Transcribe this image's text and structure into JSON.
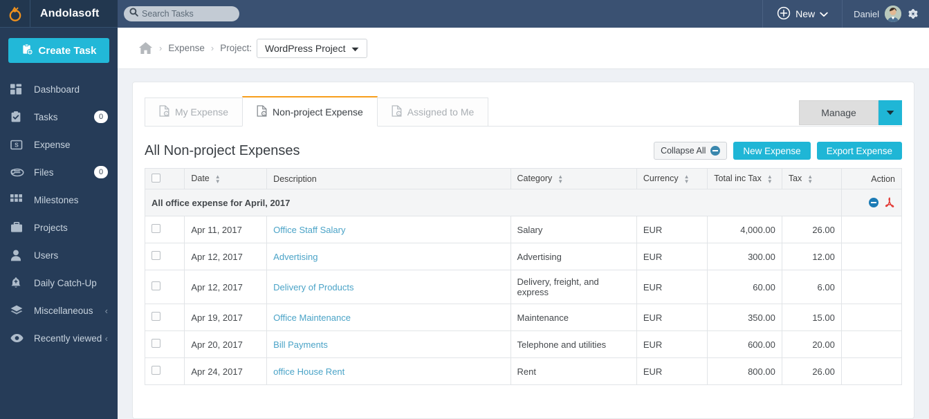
{
  "brand": {
    "name": "Andolasoft",
    "logo_icon": "ring-logo-icon"
  },
  "sidebar": {
    "create_task_label": "Create Task",
    "items": [
      {
        "label": "Dashboard",
        "icon": "dashboard-icon",
        "badge": "",
        "caret": ""
      },
      {
        "label": "Tasks",
        "icon": "tasks-clipboard-icon",
        "badge": "0",
        "caret": ""
      },
      {
        "label": "Expense",
        "icon": "expense-money-icon",
        "badge": "",
        "caret": ""
      },
      {
        "label": "Files",
        "icon": "paperclip-icon",
        "badge": "0",
        "caret": ""
      },
      {
        "label": "Milestones",
        "icon": "grid-icon",
        "badge": "",
        "caret": ""
      },
      {
        "label": "Projects",
        "icon": "briefcase-icon",
        "badge": "",
        "caret": ""
      },
      {
        "label": "Users",
        "icon": "user-icon",
        "badge": "",
        "caret": ""
      },
      {
        "label": "Daily Catch-Up",
        "icon": "bell-icon",
        "badge": "",
        "caret": ""
      },
      {
        "label": "Miscellaneous",
        "icon": "layers-icon",
        "badge": "",
        "caret": "‹"
      },
      {
        "label": "Recently viewed",
        "icon": "eye-icon",
        "badge": "",
        "caret": "‹"
      }
    ]
  },
  "topbar": {
    "search_placeholder": "Search Tasks",
    "search_value": "",
    "search_icon": "search-icon",
    "new_label": "New",
    "new_icon": "plus-circle-icon",
    "user_name": "Daniel",
    "gear_icon": "gear-icon",
    "avatar_icon": "avatar"
  },
  "breadcrumb": {
    "home_icon": "home-icon",
    "separator": "›",
    "expense_label": "Expense",
    "project_label": "Project:",
    "project_selected": "WordPress Project"
  },
  "tabs": [
    {
      "label": "My Expense",
      "icon": "expense-doc-icon",
      "active": false
    },
    {
      "label": "Non-project Expense",
      "icon": "expense-doc-icon",
      "active": true
    },
    {
      "label": "Assigned to Me",
      "icon": "expense-doc-icon",
      "active": false
    }
  ],
  "manage": {
    "label": "Manage",
    "caret_icon": "chevron-down-icon"
  },
  "main": {
    "title": "All Non-project Expenses",
    "collapse_all_label": "Collapse All",
    "collapse_icon": "minus-circle-icon",
    "new_expense_label": "New Expense",
    "export_expense_label": "Export Expense"
  },
  "table": {
    "columns": [
      {
        "label": "",
        "key": "check",
        "align": "left",
        "sortable": false
      },
      {
        "label": "Date",
        "key": "date",
        "align": "left",
        "sortable": true
      },
      {
        "label": "Description",
        "key": "description",
        "align": "left",
        "sortable": false
      },
      {
        "label": "Category",
        "key": "category",
        "align": "left",
        "sortable": true
      },
      {
        "label": "Currency",
        "key": "currency",
        "align": "left",
        "sortable": true
      },
      {
        "label": "Total inc Tax",
        "key": "total",
        "align": "right",
        "sortable": true
      },
      {
        "label": "Tax",
        "key": "tax",
        "align": "right",
        "sortable": true
      },
      {
        "label": "Action",
        "key": "action",
        "align": "right",
        "sortable": false
      }
    ],
    "group": {
      "title": "All office expense for April, 2017",
      "collapse_icon": "minus-circle-icon",
      "pdf_icon": "pdf-icon"
    },
    "rows": [
      {
        "date": "Apr 11, 2017",
        "description": "Office Staff Salary",
        "category": "Salary",
        "currency": "EUR",
        "total": "4,000.00",
        "tax": "26.00"
      },
      {
        "date": "Apr 12, 2017",
        "description": "Advertising",
        "category": "Advertising",
        "currency": "EUR",
        "total": "300.00",
        "tax": "12.00"
      },
      {
        "date": "Apr 12, 2017",
        "description": "Delivery of Products",
        "category": "Delivery, freight, and express",
        "currency": "EUR",
        "total": "60.00",
        "tax": "6.00"
      },
      {
        "date": "Apr 19, 2017",
        "description": "Office Maintenance",
        "category": "Maintenance",
        "currency": "EUR",
        "total": "350.00",
        "tax": "15.00"
      },
      {
        "date": "Apr 20, 2017",
        "description": "Bill Payments",
        "category": "Telephone and utilities",
        "currency": "EUR",
        "total": "600.00",
        "tax": "20.00"
      },
      {
        "date": "Apr 24, 2017",
        "description": "office House Rent",
        "category": "Rent",
        "currency": "EUR",
        "total": "800.00",
        "tax": "26.00"
      }
    ]
  },
  "colors": {
    "sidebar_bg": "#263c58",
    "topbar_bg": "#3a5172",
    "accent_cyan": "#1fb6d6",
    "active_tab_orange": "#f79e1b",
    "link_blue": "#4aa3c7",
    "logo_orange": "#f0921e"
  }
}
